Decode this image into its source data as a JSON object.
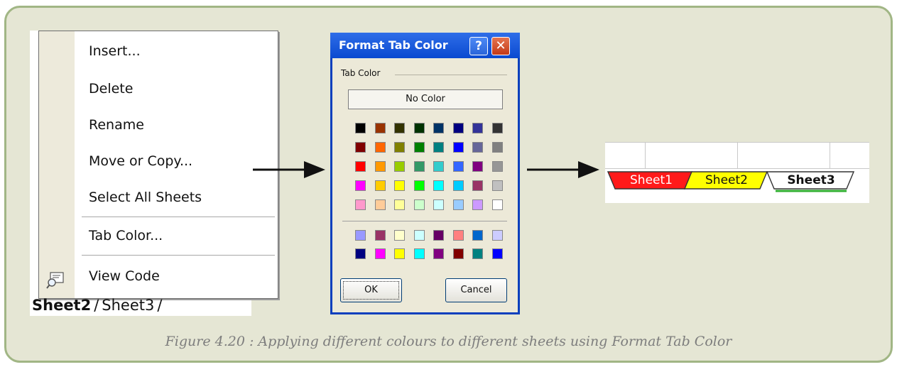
{
  "context_menu": {
    "items": [
      "Insert...",
      "Delete",
      "Rename",
      "Move or Copy...",
      "Select All Sheets",
      "Tab Color...",
      "View Code"
    ],
    "icon": "view-code-icon"
  },
  "left_sheet_tabs": {
    "tab_active": "Sheet2",
    "tab_other": "Sheet3",
    "separator": "/"
  },
  "dialog": {
    "title": "Format Tab Color",
    "help_label": "?",
    "close_label": "✕",
    "group_label": "Tab Color",
    "no_color_label": "No Color",
    "ok_label": "OK",
    "cancel_label": "Cancel",
    "palette_main": [
      [
        "#000000",
        "#993300",
        "#333300",
        "#003300",
        "#003366",
        "#000080",
        "#333399",
        "#333333"
      ],
      [
        "#800000",
        "#ff6600",
        "#808000",
        "#008000",
        "#008080",
        "#0000ff",
        "#666699",
        "#808080"
      ],
      [
        "#ff0000",
        "#ff9900",
        "#99cc00",
        "#339966",
        "#33cccc",
        "#3366ff",
        "#800080",
        "#969696"
      ],
      [
        "#ff00ff",
        "#ffcc00",
        "#ffff00",
        "#00ff00",
        "#00ffff",
        "#00ccff",
        "#993366",
        "#c0c0c0"
      ],
      [
        "#ff99cc",
        "#ffcc99",
        "#ffff99",
        "#ccffcc",
        "#ccffff",
        "#99ccff",
        "#cc99ff",
        "#ffffff"
      ]
    ],
    "palette_extra": [
      [
        "#9999ff",
        "#993366",
        "#ffffcc",
        "#ccffff",
        "#660066",
        "#ff8080",
        "#0066cc",
        "#ccccff"
      ],
      [
        "#000080",
        "#ff00ff",
        "#ffff00",
        "#00ffff",
        "#800080",
        "#800000",
        "#008080",
        "#0000ff"
      ]
    ]
  },
  "result_tabs": {
    "tabs": [
      {
        "label": "Sheet1",
        "color": "#ff1a1a"
      },
      {
        "label": "Sheet2",
        "color": "#ffff00"
      },
      {
        "label": "Sheet3",
        "color": "#ffffff"
      }
    ],
    "separator": "/"
  },
  "caption": "Figure 4.20 : Applying different colours to different sheets using Format Tab Color"
}
